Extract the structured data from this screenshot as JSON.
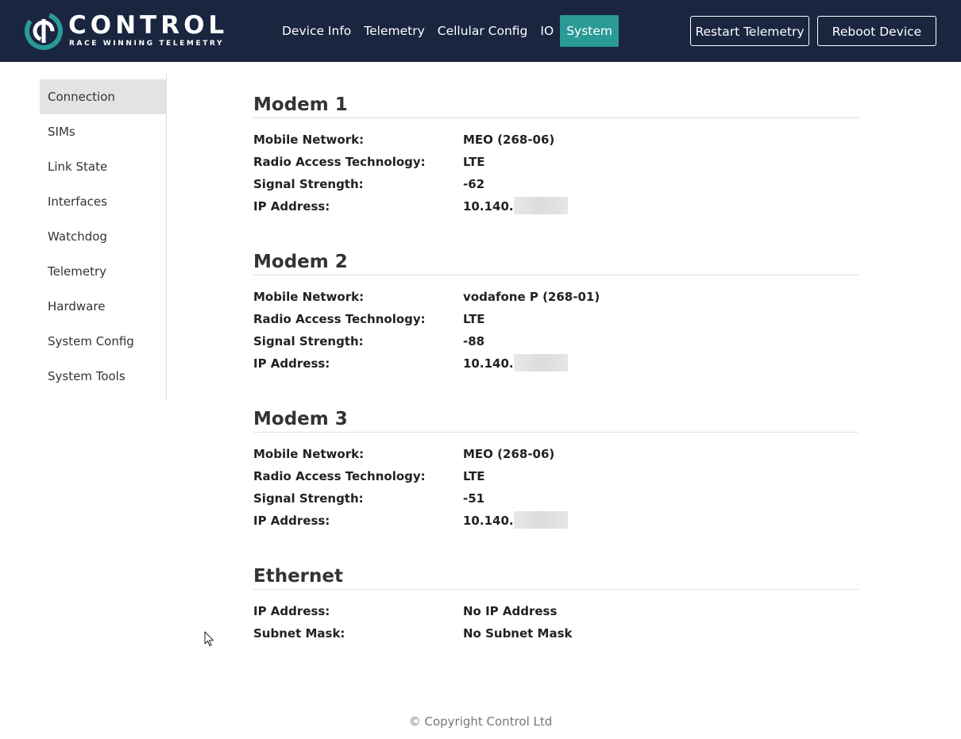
{
  "header": {
    "logo_word": "CONTROL",
    "logo_tagline": "RACE WINNING TELEMETRY",
    "nav": [
      {
        "label": "Device Info"
      },
      {
        "label": "Telemetry"
      },
      {
        "label": "Cellular Config"
      },
      {
        "label": "IO"
      },
      {
        "label": "System"
      }
    ],
    "active_nav": "System",
    "restart_label": "Restart Telemetry",
    "reboot_label": "Reboot Device",
    "colors": {
      "bar": "#1a2540",
      "accent": "#2a9a96"
    }
  },
  "sidebar": {
    "items": [
      {
        "label": "Connection"
      },
      {
        "label": "SIMs"
      },
      {
        "label": "Link State"
      },
      {
        "label": "Interfaces"
      },
      {
        "label": "Watchdog"
      },
      {
        "label": "Telemetry"
      },
      {
        "label": "Hardware"
      },
      {
        "label": "System Config"
      },
      {
        "label": "System Tools"
      }
    ],
    "active": "Connection"
  },
  "sections": [
    {
      "title": "Modem 1",
      "rows": [
        {
          "label": "Mobile Network:",
          "value": "MEO (268-06)"
        },
        {
          "label": "Radio Access Technology:",
          "value": "LTE"
        },
        {
          "label": "Signal Strength:",
          "value": "-62"
        },
        {
          "label": "IP Address:",
          "value": "10.140.",
          "redacted": true
        }
      ]
    },
    {
      "title": "Modem 2",
      "rows": [
        {
          "label": "Mobile Network:",
          "value": "vodafone P (268-01)"
        },
        {
          "label": "Radio Access Technology:",
          "value": "LTE"
        },
        {
          "label": "Signal Strength:",
          "value": "-88"
        },
        {
          "label": "IP Address:",
          "value": "10.140.",
          "redacted": true
        }
      ]
    },
    {
      "title": "Modem 3",
      "rows": [
        {
          "label": "Mobile Network:",
          "value": "MEO (268-06)"
        },
        {
          "label": "Radio Access Technology:",
          "value": "LTE"
        },
        {
          "label": "Signal Strength:",
          "value": "-51"
        },
        {
          "label": "IP Address:",
          "value": "10.140.",
          "redacted": true
        }
      ]
    },
    {
      "title": "Ethernet",
      "rows": [
        {
          "label": "IP Address:",
          "value": "No IP Address"
        },
        {
          "label": "Subnet Mask:",
          "value": "No Subnet Mask"
        }
      ]
    }
  ],
  "footer": {
    "copyright": "© Copyright Control Ltd"
  },
  "icons": {
    "logo": "control-logo-icon",
    "cursor": "mouse-cursor-icon"
  }
}
